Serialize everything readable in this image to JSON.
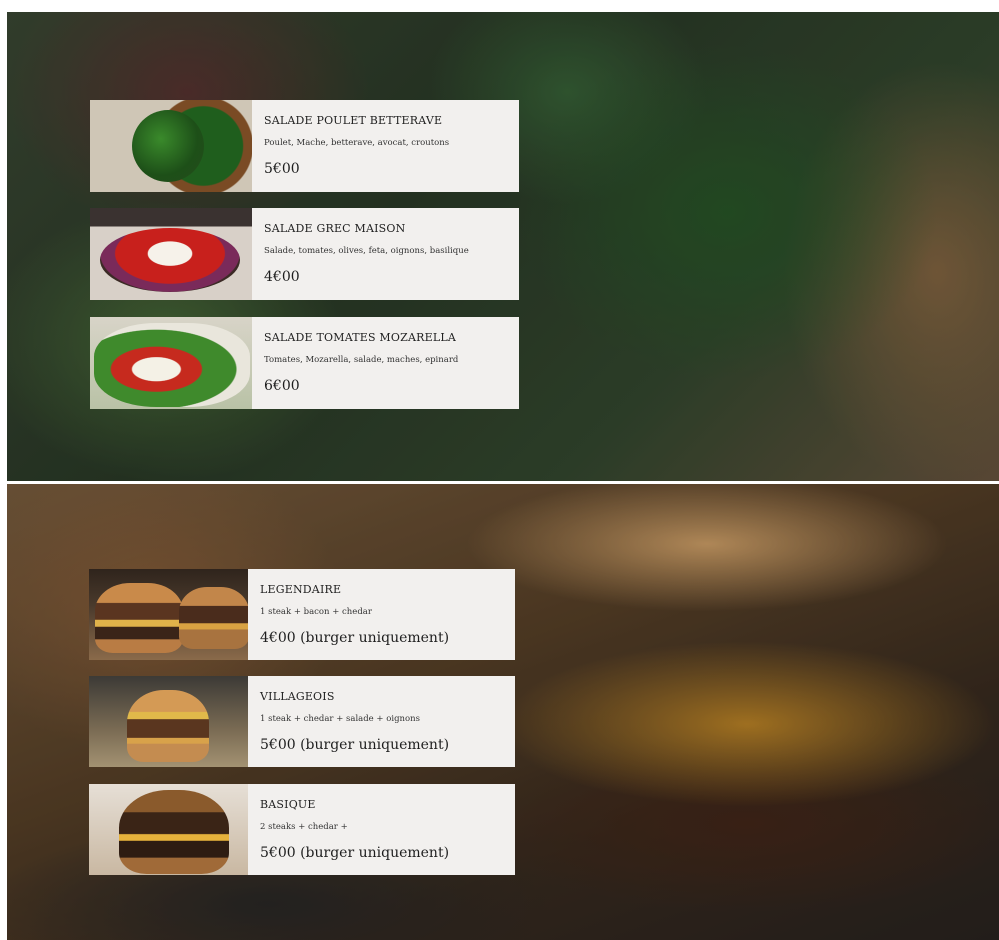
{
  "salads": {
    "items": [
      {
        "name": "SALADE POULET BETTERAVE",
        "description": "Poulet, Mache, betterave, avocat, croutons",
        "price": "5€00"
      },
      {
        "name": "SALADE GREC MAISON",
        "description": "Salade, tomates, olives, feta, oignons, basilique",
        "price": "4€00"
      },
      {
        "name": "SALADE TOMATES MOZARELLA",
        "description": "Tomates, Mozarella, salade, maches, epinard",
        "price": "6€00"
      }
    ]
  },
  "burgers": {
    "items": [
      {
        "name": "LEGENDAIRE",
        "description": "1 steak + bacon + chedar",
        "price": "4€00 (burger uniquement)"
      },
      {
        "name": "VILLAGEOIS",
        "description": "1 steak + chedar + salade + oignons",
        "price": "5€00 (burger uniquement)"
      },
      {
        "name": "BASIQUE",
        "description": "2 steaks + chedar +",
        "price": "5€00 (burger uniquement)"
      }
    ]
  }
}
